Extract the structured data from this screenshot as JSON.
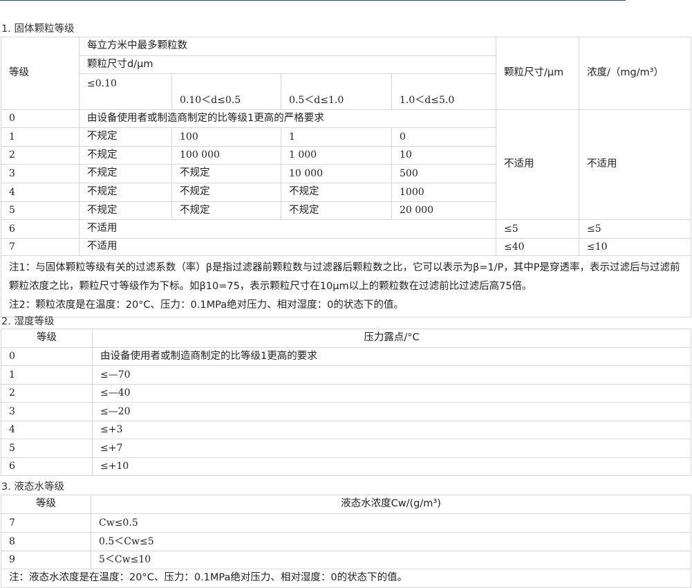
{
  "section1": {
    "title": "1. 固体颗粒等级",
    "header": {
      "grade": "等级",
      "max_per_m3": "每立方米中最多颗粒数",
      "particle_size": "颗粒尺寸d/μm",
      "size_col1": "≤0.10",
      "size_col2": "0.10＜d≤0.5",
      "size_col3": "0.5＜d≤1.0",
      "size_col4": "1.0＜d≤5.0",
      "particle_size_um": "颗粒尺寸/μm",
      "concentration": "浓度/（mg/m³）"
    },
    "row0": {
      "grade": "0",
      "text": "由设备使用者或制造商制定的比等级1更高的严格要求"
    },
    "rows": [
      {
        "grade": "1",
        "c1": "不规定",
        "c2": "100",
        "c3": "1",
        "c4": "0"
      },
      {
        "grade": "2",
        "c1": "不规定",
        "c2": "100 000",
        "c3": "1 000",
        "c4": "10"
      },
      {
        "grade": "3",
        "c1": "不规定",
        "c2": "不规定",
        "c3": "10 000",
        "c4": "500"
      },
      {
        "grade": "4",
        "c1": "不规定",
        "c2": "不规定",
        "c3": "不规定",
        "c4": "1000"
      },
      {
        "grade": "5",
        "c1": "不规定",
        "c2": "不规定",
        "c3": "不规定",
        "c4": "20 000"
      }
    ],
    "not_applicable_size": "不适用",
    "not_applicable_conc": "不适用",
    "row6": {
      "grade": "6",
      "text": "不适用",
      "size": "≤5",
      "conc": "≤5"
    },
    "row7": {
      "grade": "7",
      "text": "不适用",
      "size": "≤40",
      "conc": "≤10"
    },
    "note1": "注1：与固体颗粒等级有关的过滤系数（率）β是指过滤器前颗粒数与过滤器后颗粒数之比，它可以表示为β=1/P，其中P是穿透率，表示过滤后与过滤前颗粒浓度之比，颗粒尺寸等级作为下标。如β10=75，表示颗粒尺寸在10μm以上的颗粒数在过滤前比过滤后高75倍。",
    "note2": "注2：颗粒浓度是在温度：20°C、压力：0.1MPa绝对压力、相对湿度：0的状态下的值。"
  },
  "section2": {
    "title": "2. 湿度等级",
    "header": {
      "grade": "等级",
      "dew_point": "压力露点/°C"
    },
    "rows": [
      {
        "grade": "0",
        "value": "由设备使用者或制造商制定的比等级1更高的要求"
      },
      {
        "grade": "1",
        "value": "≤—70"
      },
      {
        "grade": "2",
        "value": "≤—40"
      },
      {
        "grade": "3",
        "value": "≤—20"
      },
      {
        "grade": "4",
        "value": "≤+3"
      },
      {
        "grade": "5",
        "value": "≤+7"
      },
      {
        "grade": "6",
        "value": "≤+10"
      }
    ]
  },
  "section3": {
    "title": "3. 液态水等级",
    "header": {
      "grade": "等级",
      "concentration": "液态水浓度Cw/(g/m³)"
    },
    "rows": [
      {
        "grade": "7",
        "value": "Cw≤0.5"
      },
      {
        "grade": "8",
        "value": "0.5＜Cw≤5"
      },
      {
        "grade": "9",
        "value": "5＜Cw≤10"
      }
    ],
    "note": "注：液态水浓度是在温度：20°C、压力：0.1MPa绝对压力、相对湿度：0的状态下的值。"
  }
}
